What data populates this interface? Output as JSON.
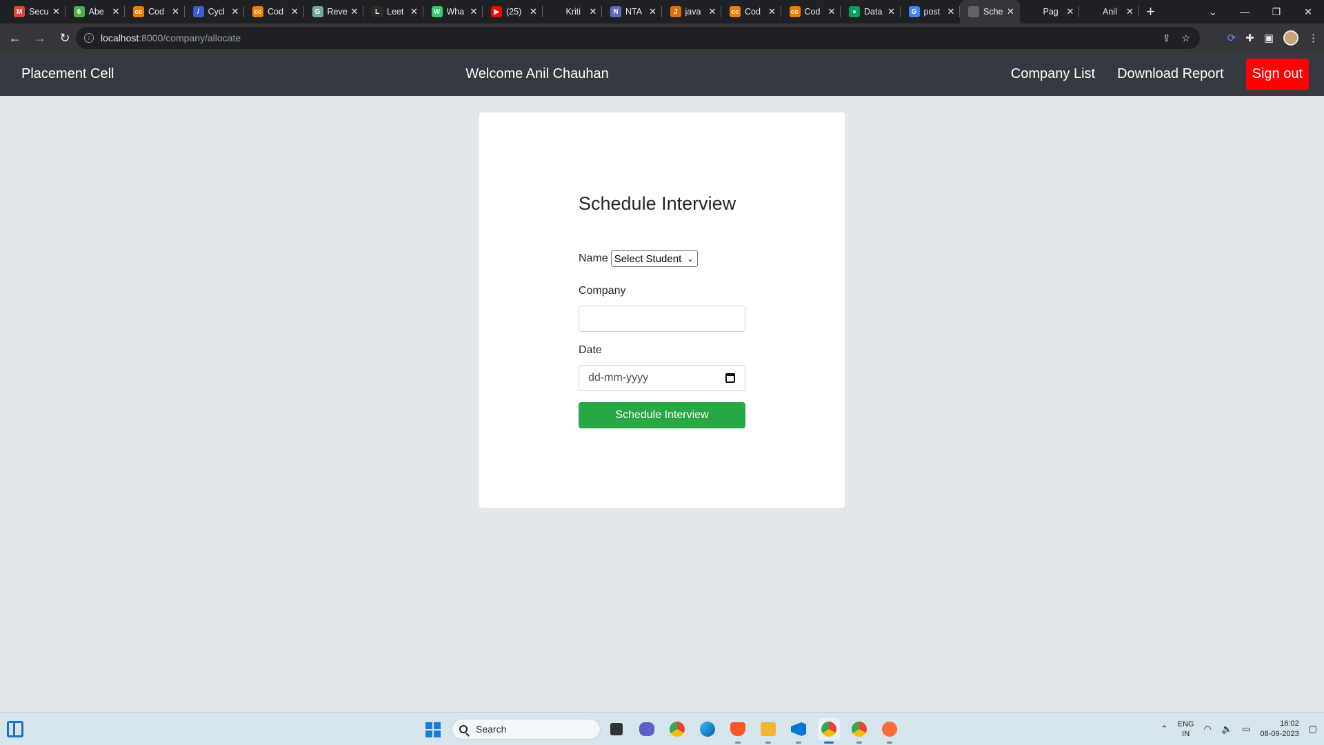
{
  "browser": {
    "tabs": [
      {
        "title": "Secu",
        "favicon_color": "#ea4335",
        "favicon_text": "M",
        "icon": "gmail-icon"
      },
      {
        "title": "Abe",
        "favicon_color": "#4caf50",
        "favicon_text": "6",
        "icon": "abe-icon"
      },
      {
        "title": "Cod",
        "favicon_color": "#f57c00",
        "favicon_text": "cc",
        "icon": "codechef-icon"
      },
      {
        "title": "Cycl",
        "favicon_color": "#3b5bdb",
        "favicon_text": "/",
        "icon": "cycle-icon"
      },
      {
        "title": "Cod",
        "favicon_color": "#f57c00",
        "favicon_text": "cc",
        "icon": "codechef-icon"
      },
      {
        "title": "Reve",
        "favicon_color": "#74aa9c",
        "favicon_text": "G",
        "icon": "chatgpt-icon"
      },
      {
        "title": "Leet",
        "favicon_color": "#2b2b2b",
        "favicon_text": "L",
        "icon": "leetcode-icon"
      },
      {
        "title": "Wha",
        "favicon_color": "#25d366",
        "favicon_text": "W",
        "icon": "whatsapp-icon"
      },
      {
        "title": "(25)",
        "favicon_color": "#ff0000",
        "favicon_text": "▶",
        "icon": "youtube-icon"
      },
      {
        "title": "Kriti",
        "favicon_color": "#202124",
        "favicon_text": "",
        "icon": "blank-icon"
      },
      {
        "title": "NTA",
        "favicon_color": "#5c6bc0",
        "favicon_text": "N",
        "icon": "nta-icon"
      },
      {
        "title": "java",
        "favicon_color": "#e76f00",
        "favicon_text": "J",
        "icon": "java-icon"
      },
      {
        "title": "Cod",
        "favicon_color": "#f57c00",
        "favicon_text": "cc",
        "icon": "codechef-icon"
      },
      {
        "title": "Cod",
        "favicon_color": "#f57c00",
        "favicon_text": "cc",
        "icon": "codechef-icon"
      },
      {
        "title": "Data",
        "favicon_color": "#00a35c",
        "favicon_text": "●",
        "icon": "mongodb-icon"
      },
      {
        "title": "post",
        "favicon_color": "#4285f4",
        "favicon_text": "G",
        "icon": "google-icon"
      },
      {
        "title": "Sche",
        "favicon_color": "#5f6368",
        "favicon_text": "",
        "icon": "globe-icon",
        "active": true
      },
      {
        "title": "Pag",
        "favicon_color": "#202124",
        "favicon_text": "",
        "icon": "blank-icon"
      },
      {
        "title": "Anil",
        "favicon_color": "#202124",
        "favicon_text": "",
        "icon": "blank-icon"
      }
    ],
    "url_host": "localhost",
    "url_rest": ":8000/company/allocate"
  },
  "navbar": {
    "brand": "Placement Cell",
    "welcome": "Welcome Anil Chauhan",
    "links": [
      "Company List",
      "Download Report"
    ],
    "signout": "Sign out",
    "signout_color": "#ff0000"
  },
  "form": {
    "title": "Schedule Interview",
    "name_label": "Name",
    "name_select_value": "Select Student",
    "company_label": "Company",
    "company_value": "",
    "date_label": "Date",
    "date_placeholder": "dd-mm-yyyy",
    "submit_label": "Schedule Interview",
    "submit_color": "#28a745"
  },
  "taskbar": {
    "search_placeholder": "Search",
    "lang_top": "ENG",
    "lang_bottom": "IN",
    "time": "16:02",
    "date": "08-09-2023"
  }
}
